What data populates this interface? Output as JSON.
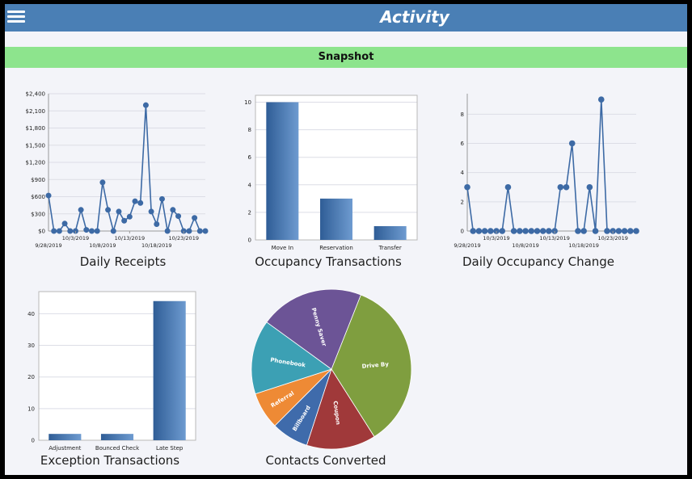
{
  "app": {
    "title": "Activity",
    "menu_icon": "hamburger-icon"
  },
  "snapshot": {
    "title": "Snapshot",
    "color": "#8de48d"
  },
  "colors": {
    "header": "#4a7fb5",
    "bar": "#3d6aa5",
    "line": "#3d6aa5",
    "background": "#f3f4f9"
  },
  "chart_data": [
    {
      "id": "daily-receipts",
      "type": "line",
      "title": "Daily Receipts",
      "y_ticks": [
        "$0",
        "$300",
        "$600",
        "$900",
        "$1,200",
        "$1,500",
        "$1,800",
        "$2,100",
        "$2,400"
      ],
      "ylim": [
        0,
        2400
      ],
      "x_labels_row1": [
        "10/3/2019",
        "10/13/2019",
        "10/23/2019"
      ],
      "x_labels_row2": [
        "9/28/2019",
        "10/8/2019",
        "10/18/2019"
      ],
      "values": [
        620,
        0,
        0,
        130,
        0,
        0,
        370,
        20,
        0,
        0,
        850,
        370,
        0,
        340,
        180,
        250,
        520,
        490,
        2200,
        340,
        120,
        560,
        0,
        370,
        260,
        0,
        0,
        230,
        0,
        0
      ],
      "grid": true
    },
    {
      "id": "occupancy-transactions",
      "type": "bar",
      "title": "Occupancy Transactions",
      "categories": [
        "Move In",
        "Reservation",
        "Transfer"
      ],
      "values": [
        10,
        3,
        1
      ],
      "y_ticks": [
        "0",
        "2",
        "4",
        "6",
        "8",
        "10"
      ],
      "ylim": [
        0,
        10.5
      ],
      "grid": true
    },
    {
      "id": "daily-occupancy-change",
      "type": "line",
      "title": "Daily Occupancy Change",
      "y_ticks": [
        "0",
        "2",
        "4",
        "6",
        "8"
      ],
      "ylim": [
        0,
        9.4
      ],
      "x_labels_row1": [
        "10/3/2019",
        "10/13/2019",
        "10/23/2019"
      ],
      "x_labels_row2": [
        "9/28/2019",
        "10/8/2019",
        "10/18/2019"
      ],
      "values": [
        3,
        0,
        0,
        0,
        0,
        0,
        0,
        3,
        0,
        0,
        0,
        0,
        0,
        0,
        0,
        0,
        3,
        3,
        6,
        0,
        0,
        3,
        0,
        9,
        0,
        0,
        0,
        0,
        0,
        0
      ],
      "grid": true
    },
    {
      "id": "exception-transactions",
      "type": "bar",
      "title": "Exception Transactions",
      "categories": [
        "Adjustment",
        "Bounced Check",
        "Late Step"
      ],
      "values": [
        2,
        2,
        44
      ],
      "y_ticks": [
        "0",
        "10",
        "20",
        "30",
        "40"
      ],
      "ylim": [
        0,
        47
      ],
      "grid": true
    },
    {
      "id": "contacts-converted",
      "type": "pie",
      "title": "Contacts Converted",
      "slices": [
        {
          "label": "Drive By",
          "value": 35,
          "color": "#7f9e3f"
        },
        {
          "label": "Coupon",
          "value": 14,
          "color": "#a0393a"
        },
        {
          "label": "Billboard",
          "value": 7.5,
          "color": "#3f6bab"
        },
        {
          "label": "Referral",
          "value": 7.5,
          "color": "#ee8a35"
        },
        {
          "label": "Phonebook",
          "value": 15,
          "color": "#3ca0b4"
        },
        {
          "label": "Penny Saver",
          "value": 21,
          "color": "#6c5496"
        }
      ]
    }
  ]
}
